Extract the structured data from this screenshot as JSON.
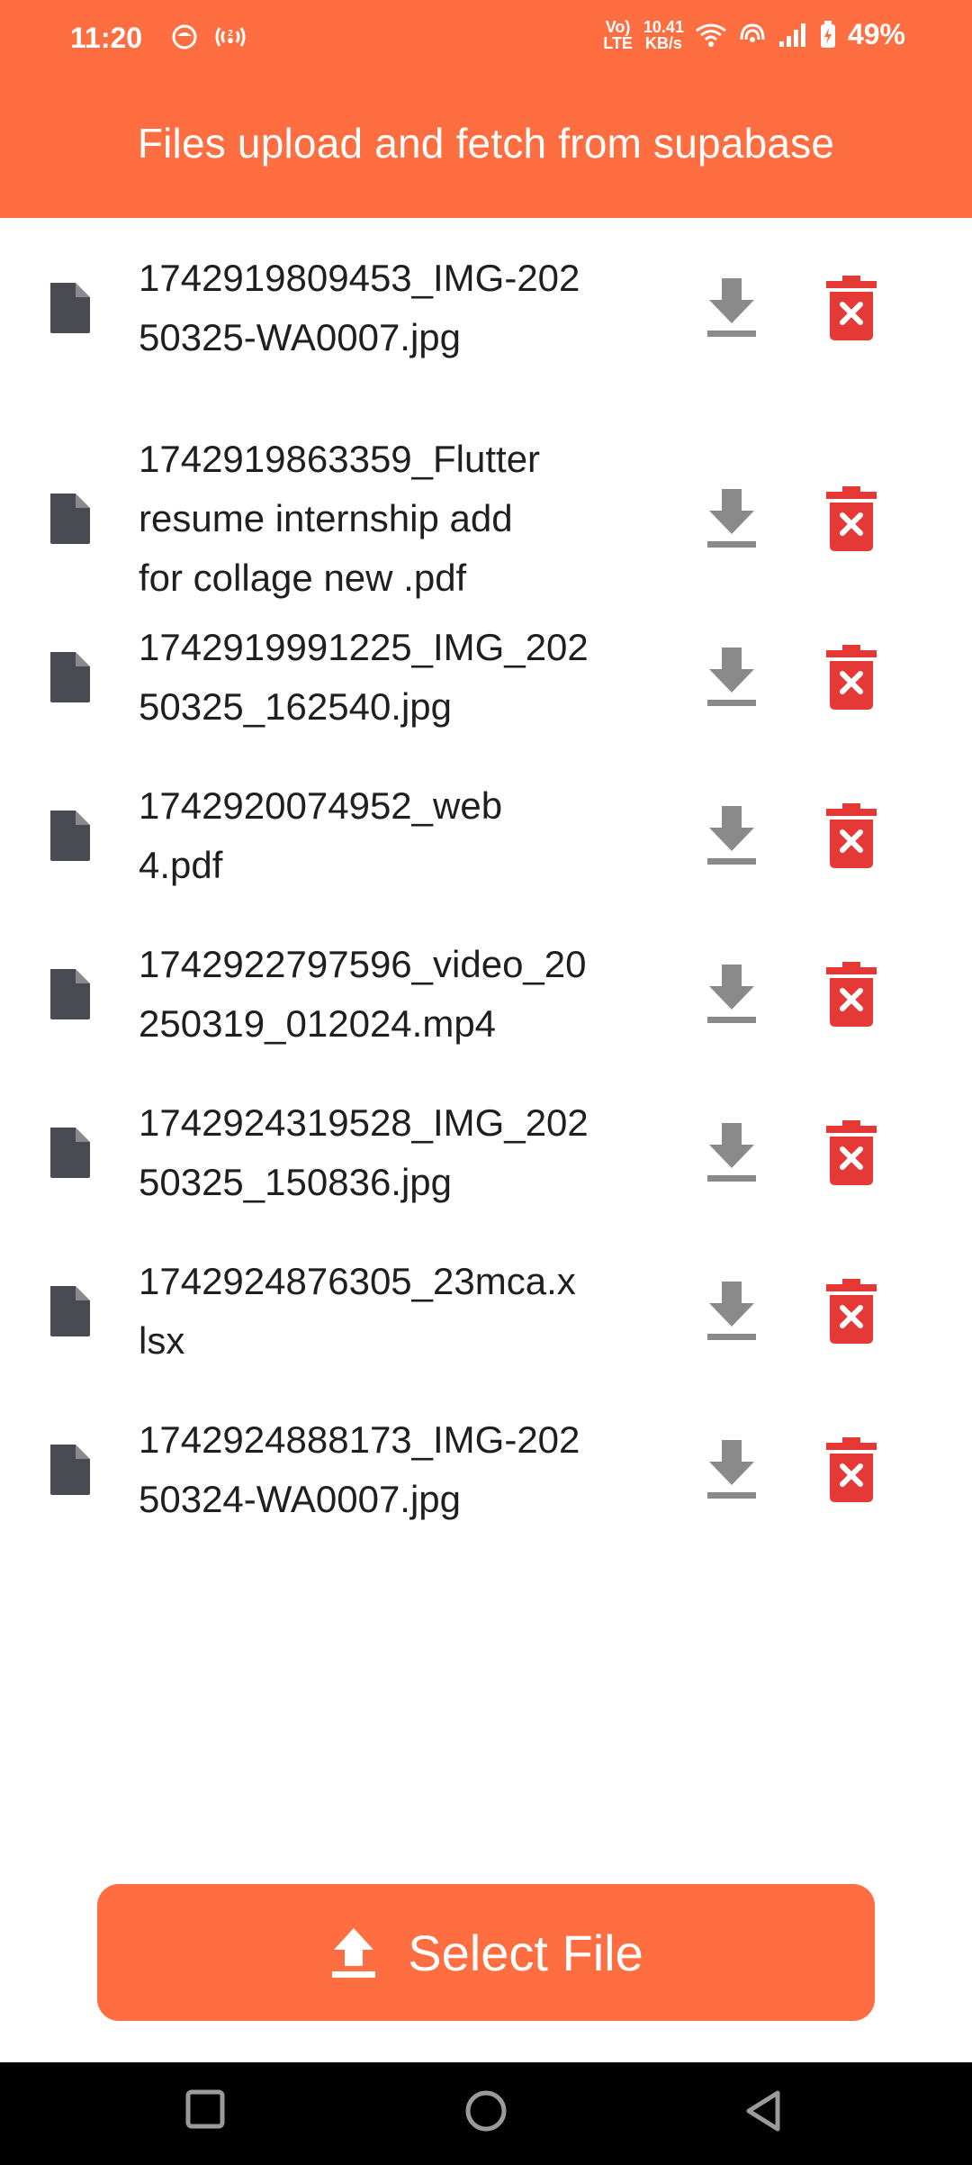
{
  "status_bar": {
    "time": "11:20",
    "network_top": "Vo)",
    "network_bottom": "LTE",
    "speed_top": "10.41",
    "speed_bottom": "KB/s",
    "battery": "49%"
  },
  "app_bar": {
    "title": "Files upload and fetch from supabase"
  },
  "files": [
    {
      "name": "1742919809453_IMG-20250325-WA0007.jpg",
      "lines": [
        "1742919809453_IMG-202",
        "50325-WA0007.jpg"
      ]
    },
    {
      "name": "1742919863359_Flutter resume internship add for collage new .pdf",
      "lines": [
        "1742919863359_Flutter",
        "resume internship add",
        "for collage new .pdf"
      ]
    },
    {
      "name": "1742919991225_IMG_20250325_162540.jpg",
      "lines": [
        "1742919991225_IMG_202",
        "50325_162540.jpg"
      ]
    },
    {
      "name": "1742920074952_web 4.pdf",
      "lines": [
        "1742920074952_web",
        "4.pdf"
      ]
    },
    {
      "name": "1742922797596_video_20250319_012024.mp4",
      "lines": [
        "1742922797596_video_20",
        "250319_012024.mp4"
      ]
    },
    {
      "name": "1742924319528_IMG_20250325_150836.jpg",
      "lines": [
        "1742924319528_IMG_202",
        "50325_150836.jpg"
      ]
    },
    {
      "name": "1742924876305_23mca.xlsx",
      "lines": [
        "1742924876305_23mca.x",
        "lsx"
      ]
    },
    {
      "name": "1742924888173_IMG-20250324-WA0007.jpg",
      "lines": [
        "1742924888173_IMG-202",
        "50324-WA0007.jpg"
      ]
    }
  ],
  "select_button": {
    "label": "Select File",
    "icon": "upload-icon"
  },
  "colors": {
    "accent": "#ff6e40",
    "delete": "#e53935",
    "download": "#8a8a8a",
    "file_icon": "#4a4a52"
  },
  "icons": {
    "file": "file-icon",
    "download": "download-icon",
    "delete": "delete-icon"
  }
}
